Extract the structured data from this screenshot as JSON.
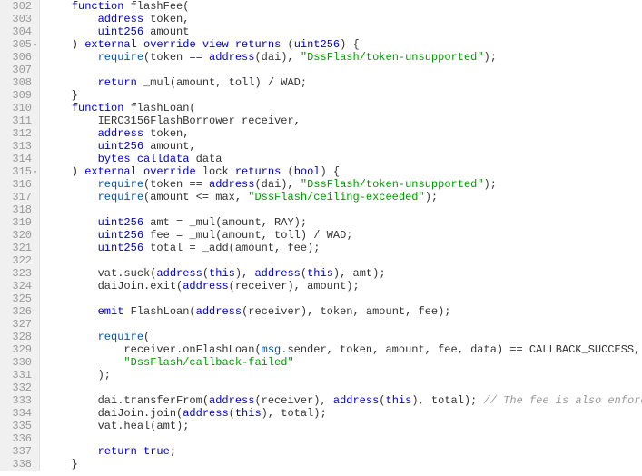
{
  "lines": [
    {
      "num": "302",
      "fold": "",
      "segments": [
        {
          "t": "    ",
          "c": ""
        },
        {
          "t": "function",
          "c": "kw"
        },
        {
          "t": " flashFee(",
          "c": ""
        }
      ]
    },
    {
      "num": "303",
      "fold": "",
      "segments": [
        {
          "t": "        ",
          "c": ""
        },
        {
          "t": "address",
          "c": "type"
        },
        {
          "t": " token,",
          "c": ""
        }
      ]
    },
    {
      "num": "304",
      "fold": "",
      "segments": [
        {
          "t": "        ",
          "c": ""
        },
        {
          "t": "uint256",
          "c": "type"
        },
        {
          "t": " amount",
          "c": ""
        }
      ]
    },
    {
      "num": "305",
      "fold": "▾",
      "segments": [
        {
          "t": "    ) ",
          "c": ""
        },
        {
          "t": "external",
          "c": "kw"
        },
        {
          "t": " ",
          "c": ""
        },
        {
          "t": "override",
          "c": "kw"
        },
        {
          "t": " ",
          "c": ""
        },
        {
          "t": "view",
          "c": "kw"
        },
        {
          "t": " ",
          "c": ""
        },
        {
          "t": "returns",
          "c": "kw"
        },
        {
          "t": " (",
          "c": ""
        },
        {
          "t": "uint256",
          "c": "type"
        },
        {
          "t": ") {",
          "c": ""
        }
      ]
    },
    {
      "num": "306",
      "fold": "",
      "segments": [
        {
          "t": "        ",
          "c": ""
        },
        {
          "t": "require",
          "c": "builtin"
        },
        {
          "t": "(token == ",
          "c": ""
        },
        {
          "t": "address",
          "c": "type"
        },
        {
          "t": "(dai), ",
          "c": ""
        },
        {
          "t": "\"DssFlash/token-unsupported\"",
          "c": "str"
        },
        {
          "t": ");",
          "c": ""
        }
      ]
    },
    {
      "num": "307",
      "fold": "",
      "segments": [
        {
          "t": "",
          "c": ""
        }
      ]
    },
    {
      "num": "308",
      "fold": "",
      "segments": [
        {
          "t": "        ",
          "c": ""
        },
        {
          "t": "return",
          "c": "kw"
        },
        {
          "t": " _mul(amount, toll) / WAD;",
          "c": ""
        }
      ]
    },
    {
      "num": "309",
      "fold": "",
      "segments": [
        {
          "t": "    }",
          "c": ""
        }
      ]
    },
    {
      "num": "310",
      "fold": "",
      "segments": [
        {
          "t": "    ",
          "c": ""
        },
        {
          "t": "function",
          "c": "kw"
        },
        {
          "t": " flashLoan(",
          "c": ""
        }
      ]
    },
    {
      "num": "311",
      "fold": "",
      "segments": [
        {
          "t": "        IERC3156FlashBorrower receiver,",
          "c": ""
        }
      ]
    },
    {
      "num": "312",
      "fold": "",
      "segments": [
        {
          "t": "        ",
          "c": ""
        },
        {
          "t": "address",
          "c": "type"
        },
        {
          "t": " token,",
          "c": ""
        }
      ]
    },
    {
      "num": "313",
      "fold": "",
      "segments": [
        {
          "t": "        ",
          "c": ""
        },
        {
          "t": "uint256",
          "c": "type"
        },
        {
          "t": " amount,",
          "c": ""
        }
      ]
    },
    {
      "num": "314",
      "fold": "",
      "segments": [
        {
          "t": "        ",
          "c": ""
        },
        {
          "t": "bytes",
          "c": "type"
        },
        {
          "t": " ",
          "c": ""
        },
        {
          "t": "calldata",
          "c": "kw"
        },
        {
          "t": " data",
          "c": ""
        }
      ]
    },
    {
      "num": "315",
      "fold": "▾",
      "segments": [
        {
          "t": "    ) ",
          "c": ""
        },
        {
          "t": "external",
          "c": "kw"
        },
        {
          "t": " ",
          "c": ""
        },
        {
          "t": "override",
          "c": "kw"
        },
        {
          "t": " lock ",
          "c": ""
        },
        {
          "t": "returns",
          "c": "kw"
        },
        {
          "t": " (",
          "c": ""
        },
        {
          "t": "bool",
          "c": "type"
        },
        {
          "t": ") {",
          "c": ""
        }
      ]
    },
    {
      "num": "316",
      "fold": "",
      "segments": [
        {
          "t": "        ",
          "c": ""
        },
        {
          "t": "require",
          "c": "builtin"
        },
        {
          "t": "(token == ",
          "c": ""
        },
        {
          "t": "address",
          "c": "type"
        },
        {
          "t": "(dai), ",
          "c": ""
        },
        {
          "t": "\"DssFlash/token-unsupported\"",
          "c": "str"
        },
        {
          "t": ");",
          "c": ""
        }
      ]
    },
    {
      "num": "317",
      "fold": "",
      "segments": [
        {
          "t": "        ",
          "c": ""
        },
        {
          "t": "require",
          "c": "builtin"
        },
        {
          "t": "(amount <= max, ",
          "c": ""
        },
        {
          "t": "\"DssFlash/ceiling-exceeded\"",
          "c": "str"
        },
        {
          "t": ");",
          "c": ""
        }
      ]
    },
    {
      "num": "318",
      "fold": "",
      "segments": [
        {
          "t": "",
          "c": ""
        }
      ]
    },
    {
      "num": "319",
      "fold": "",
      "segments": [
        {
          "t": "        ",
          "c": ""
        },
        {
          "t": "uint256",
          "c": "type"
        },
        {
          "t": " amt = _mul(amount, RAY);",
          "c": ""
        }
      ]
    },
    {
      "num": "320",
      "fold": "",
      "segments": [
        {
          "t": "        ",
          "c": ""
        },
        {
          "t": "uint256",
          "c": "type"
        },
        {
          "t": " fee = _mul(amount, toll) / WAD;",
          "c": ""
        }
      ]
    },
    {
      "num": "321",
      "fold": "",
      "segments": [
        {
          "t": "        ",
          "c": ""
        },
        {
          "t": "uint256",
          "c": "type"
        },
        {
          "t": " total = _add(amount, fee);",
          "c": ""
        }
      ]
    },
    {
      "num": "322",
      "fold": "",
      "segments": [
        {
          "t": "",
          "c": ""
        }
      ]
    },
    {
      "num": "323",
      "fold": "",
      "segments": [
        {
          "t": "        vat.suck(",
          "c": ""
        },
        {
          "t": "address",
          "c": "type"
        },
        {
          "t": "(",
          "c": ""
        },
        {
          "t": "this",
          "c": "kw"
        },
        {
          "t": "), ",
          "c": ""
        },
        {
          "t": "address",
          "c": "type"
        },
        {
          "t": "(",
          "c": ""
        },
        {
          "t": "this",
          "c": "kw"
        },
        {
          "t": "), amt);",
          "c": ""
        }
      ]
    },
    {
      "num": "324",
      "fold": "",
      "segments": [
        {
          "t": "        daiJoin.exit(",
          "c": ""
        },
        {
          "t": "address",
          "c": "type"
        },
        {
          "t": "(receiver), amount);",
          "c": ""
        }
      ]
    },
    {
      "num": "325",
      "fold": "",
      "segments": [
        {
          "t": "",
          "c": ""
        }
      ]
    },
    {
      "num": "326",
      "fold": "",
      "segments": [
        {
          "t": "        ",
          "c": ""
        },
        {
          "t": "emit",
          "c": "kw"
        },
        {
          "t": " FlashLoan(",
          "c": ""
        },
        {
          "t": "address",
          "c": "type"
        },
        {
          "t": "(receiver), token, amount, fee);",
          "c": ""
        }
      ]
    },
    {
      "num": "327",
      "fold": "",
      "segments": [
        {
          "t": "",
          "c": ""
        }
      ]
    },
    {
      "num": "328",
      "fold": "",
      "segments": [
        {
          "t": "        ",
          "c": ""
        },
        {
          "t": "require",
          "c": "builtin"
        },
        {
          "t": "(",
          "c": ""
        }
      ]
    },
    {
      "num": "329",
      "fold": "",
      "segments": [
        {
          "t": "            receiver.onFlashLoan(",
          "c": ""
        },
        {
          "t": "msg",
          "c": "builtin"
        },
        {
          "t": ".sender, token, amount, fee, data) == CALLBACK_SUCCESS,",
          "c": ""
        }
      ]
    },
    {
      "num": "330",
      "fold": "",
      "segments": [
        {
          "t": "            ",
          "c": ""
        },
        {
          "t": "\"DssFlash/callback-failed\"",
          "c": "str"
        }
      ]
    },
    {
      "num": "331",
      "fold": "",
      "segments": [
        {
          "t": "        );",
          "c": ""
        }
      ]
    },
    {
      "num": "332",
      "fold": "",
      "segments": [
        {
          "t": "",
          "c": ""
        }
      ]
    },
    {
      "num": "333",
      "fold": "",
      "segments": [
        {
          "t": "        dai.transferFrom(",
          "c": ""
        },
        {
          "t": "address",
          "c": "type"
        },
        {
          "t": "(receiver), ",
          "c": ""
        },
        {
          "t": "address",
          "c": "type"
        },
        {
          "t": "(",
          "c": ""
        },
        {
          "t": "this",
          "c": "kw"
        },
        {
          "t": "), total); ",
          "c": ""
        },
        {
          "t": "// The fee is also enforced here",
          "c": "comment"
        }
      ]
    },
    {
      "num": "334",
      "fold": "",
      "segments": [
        {
          "t": "        daiJoin.join(",
          "c": ""
        },
        {
          "t": "address",
          "c": "type"
        },
        {
          "t": "(",
          "c": ""
        },
        {
          "t": "this",
          "c": "kw"
        },
        {
          "t": "), total);",
          "c": ""
        }
      ]
    },
    {
      "num": "335",
      "fold": "",
      "segments": [
        {
          "t": "        vat.heal(amt);",
          "c": ""
        }
      ]
    },
    {
      "num": "336",
      "fold": "",
      "segments": [
        {
          "t": "",
          "c": ""
        }
      ]
    },
    {
      "num": "337",
      "fold": "",
      "segments": [
        {
          "t": "        ",
          "c": ""
        },
        {
          "t": "return",
          "c": "kw"
        },
        {
          "t": " ",
          "c": ""
        },
        {
          "t": "true",
          "c": "kw"
        },
        {
          "t": ";",
          "c": ""
        }
      ]
    },
    {
      "num": "338",
      "fold": "",
      "segments": [
        {
          "t": "    }",
          "c": ""
        }
      ]
    }
  ]
}
